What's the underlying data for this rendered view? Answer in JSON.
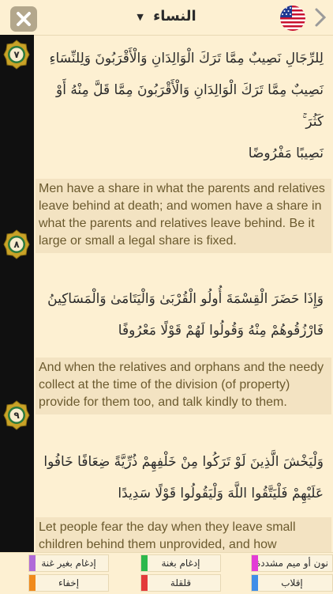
{
  "header": {
    "title": "النساء",
    "flag": "us-flag",
    "colors": {
      "close_bg": "#b3a78c"
    }
  },
  "ayahs": [
    {
      "number": "٧",
      "lines": [
        "لِلرِّجَالِ نَصِيبٌ مِمَّا تَرَكَ الْوَالِدَانِ وَالْأَقْرَبُونَ وَلِلنِّسَاءِ",
        "نَصِيبٌ مِمَّا تَرَكَ الْوَالِدَانِ وَالْأَقْرَبُونَ مِمَّا قَلَّ مِنْهُ أَوْ كَثُرَ ۚ",
        "نَصِيبًا مَفْرُوضًا"
      ],
      "translation": "Men have a share in what the parents and relatives leave behind at death; and women have a share in what the parents and relatives leave behind. Be it large or small a legal share is fixed."
    },
    {
      "number": "٨",
      "lines": [
        "وَإِذَا حَضَرَ الْقِسْمَةَ أُولُو الْقُرْبَىٰ وَالْيَتَامَىٰ وَالْمَسَاكِينُ",
        "فَارْزُقُوهُمْ مِنْهُ وَقُولُوا لَهُمْ قَوْلًا مَعْرُوفًا"
      ],
      "translation": "And when the relatives and orphans and the needy collect at the time of the division (of property) provide for them too, and talk kindly to them."
    },
    {
      "number": "٩",
      "lines": [
        "وَلْيَخْشَ الَّذِينَ لَوْ تَرَكُوا مِنْ خَلْفِهِمْ ذُرِّيَّةً ضِعَافًا خَافُوا",
        "عَلَيْهِمْ فَلْيَتَّقُوا اللَّهَ وَلْيَقُولُوا قَوْلًا سَدِيدًا"
      ],
      "translation": "Let people fear the day when they leave small children behind them unprovided, and how concerned they would be for them. So fear"
    }
  ],
  "legend": [
    {
      "label": "إدغام بغير غنة",
      "color": "#b06ad8"
    },
    {
      "label": "إدغام بغنة",
      "color": "#2db84c"
    },
    {
      "label": "نون أو ميم مشددة",
      "color": "#e33cd6"
    },
    {
      "label": "إخفاء",
      "color": "#f08a1c"
    },
    {
      "label": "قلقلة",
      "color": "#e33a3a"
    },
    {
      "label": "إقلاب",
      "color": "#3f8ee8"
    }
  ]
}
